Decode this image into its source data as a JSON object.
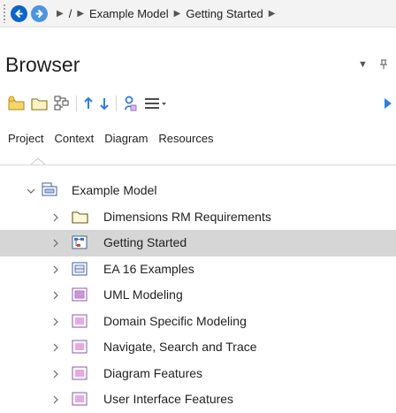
{
  "breadcrumb": {
    "root": "/",
    "items": [
      "Example Model",
      "Getting Started"
    ]
  },
  "browser": {
    "title": "Browser",
    "tabs": [
      "Project",
      "Context",
      "Diagram",
      "Resources"
    ]
  },
  "colors": {
    "nav_blue": "#0c65c8",
    "nav_blue_light": "#4d95df",
    "toolbar_arrow": "#2f7fe0",
    "selected_row": "#d6d6d6",
    "package_pink": "#e8a8e8",
    "folder_yellow": "#f5d46c"
  },
  "tree": {
    "root": {
      "label": "Example Model",
      "icon": "model-root-icon"
    },
    "children": [
      {
        "label": "Dimensions RM Requirements",
        "icon": "folder-icon"
      },
      {
        "label": "Getting Started",
        "icon": "diagram-package-icon",
        "selected": true
      },
      {
        "label": "EA 16 Examples",
        "icon": "package-icon"
      },
      {
        "label": "UML Modeling",
        "icon": "package-icon"
      },
      {
        "label": "Domain Specific Modeling",
        "icon": "package-icon"
      },
      {
        "label": "Navigate, Search and Trace",
        "icon": "package-icon"
      },
      {
        "label": "Diagram Features",
        "icon": "package-icon"
      },
      {
        "label": "User Interface Features",
        "icon": "package-icon"
      }
    ]
  }
}
